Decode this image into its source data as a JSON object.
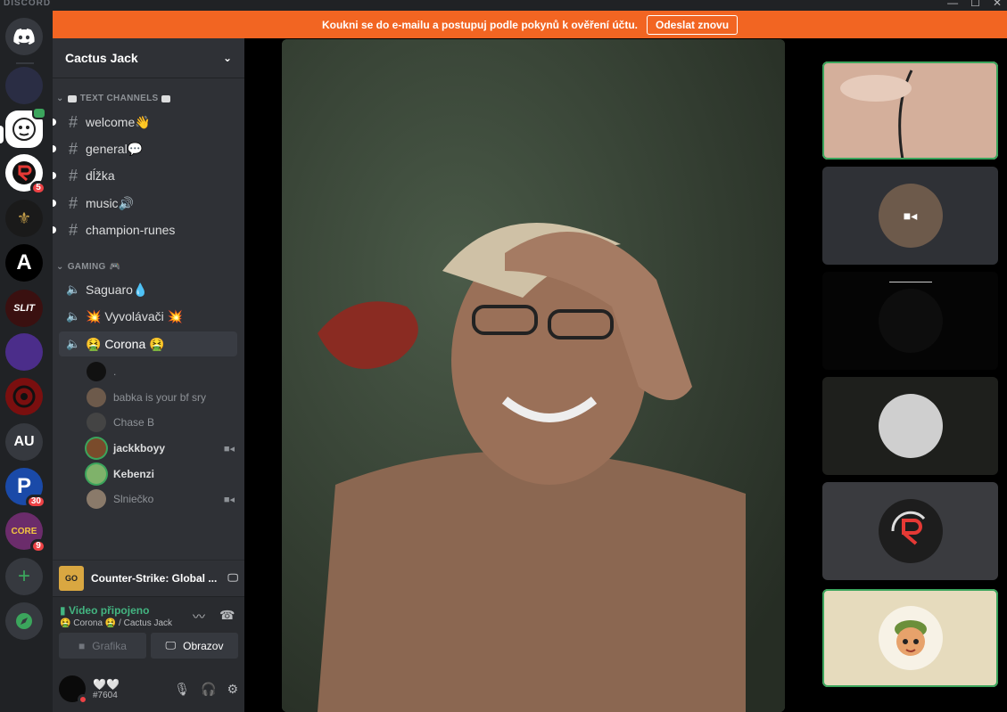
{
  "window": {
    "brand": "DISCORD",
    "controls": [
      "—",
      "☐",
      "✕"
    ]
  },
  "banner": {
    "text": "Koukni se do e-mailu a postupuj podle pokynů k ověření účtu.",
    "button": "Odeslat znovu"
  },
  "guilds": [
    {
      "label": "",
      "badge": "",
      "color": "#36393f",
      "icon": "discord-home-icon"
    },
    {
      "label": "",
      "badge": "",
      "color": "#2a2d44"
    },
    {
      "label": "",
      "badge": "",
      "color": "#ffffff"
    },
    {
      "label": "",
      "badge": "5",
      "color": "#ffffff"
    },
    {
      "label": "",
      "badge": "",
      "color": "#1a1a1a"
    },
    {
      "label": "A",
      "badge": "",
      "color": "#000000"
    },
    {
      "label": "",
      "badge": "",
      "color": "#3a1010"
    },
    {
      "label": "",
      "badge": "",
      "color": "#4b2d8a"
    },
    {
      "label": "",
      "badge": "",
      "color": "#7a0f0f"
    },
    {
      "label": "AU",
      "badge": "",
      "color": "#36393f"
    },
    {
      "label": "P",
      "badge": "30",
      "color": "#1a4aa8"
    },
    {
      "label": "",
      "badge": "9",
      "color": "#6b2c6b"
    },
    {
      "label": "+",
      "badge": "",
      "color": "#36393f",
      "icon": "add-server-icon"
    },
    {
      "label": "",
      "badge": "",
      "color": "#36393f",
      "icon": "compass-icon"
    }
  ],
  "server": {
    "name": "Cactus Jack",
    "dropdown_icon": "chevron-down-icon"
  },
  "text_category": "TEXT CHANNELS",
  "text_channels": [
    "welcome👋",
    "general💬",
    "dĺžka",
    "music🔊",
    "champion-runes"
  ],
  "gaming_category": "GAMING",
  "voice_channels": [
    "Saguaro💧",
    "💥 Vyvolávači 💥",
    "🤮 Corona 🤮"
  ],
  "voice_users": [
    {
      "name": ".",
      "camera": false,
      "bold": false
    },
    {
      "name": "babka is your bf sry",
      "camera": false,
      "bold": false
    },
    {
      "name": "Chase B",
      "camera": false,
      "bold": false
    },
    {
      "name": "jackkboyy",
      "camera": true,
      "bold": true
    },
    {
      "name": "Kebenzi",
      "camera": false,
      "bold": true
    },
    {
      "name": "Slniečko",
      "camera": true,
      "bold": false
    }
  ],
  "activity": {
    "game_icon_text": "GO",
    "game": "Counter-Strike: Global ..."
  },
  "voice_panel": {
    "status": "Video připojeno",
    "location": "🤮 Corona 🤮 / Cactus Jack",
    "btn_video": "Grafika",
    "btn_screen": "Obrazov"
  },
  "user": {
    "name": "🤍🤍",
    "tag": "#7604"
  },
  "tiles": [
    {
      "speaking": true,
      "bg": "#d9b7a4"
    },
    {
      "speaking": false,
      "bg": "#2f3136"
    },
    {
      "speaking": false,
      "bg": "#050505"
    },
    {
      "speaking": false,
      "bg": "#1e1f1c"
    },
    {
      "speaking": false,
      "bg": "#3a3b3f"
    },
    {
      "speaking": true,
      "bg": "#e6dbbd"
    }
  ]
}
